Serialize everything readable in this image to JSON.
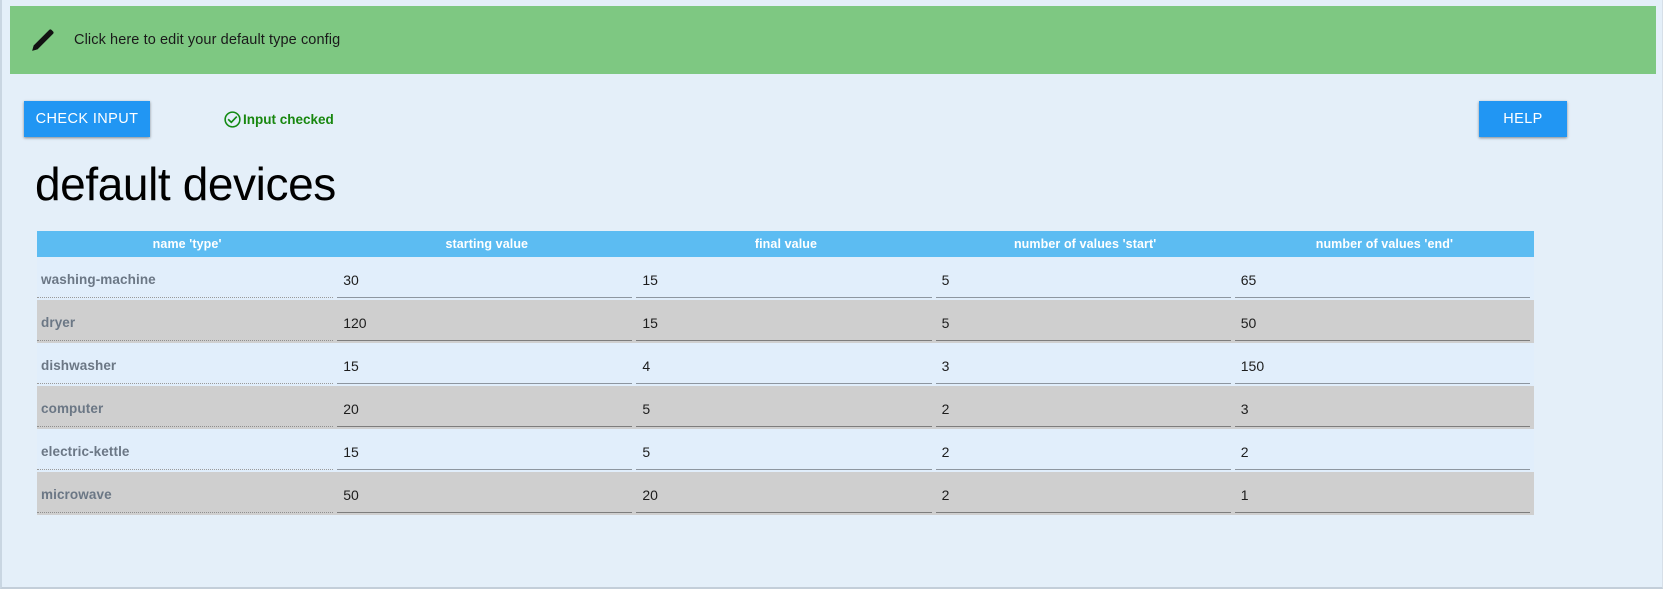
{
  "banner": {
    "icon": "pencil-icon",
    "label": "Click here to edit your default type config",
    "background": "#7ec882"
  },
  "toolbar": {
    "check_input_label": "CHECK INPUT",
    "help_label": "HELP",
    "status_icon": "check-circle-icon",
    "status_label": "Input checked",
    "status_color": "#18870f",
    "button_color": "#2196f3"
  },
  "page": {
    "title": "default devices",
    "background": "#e4eff9"
  },
  "table": {
    "header_color": "#5cbcf2",
    "row_odd_color": "#e1eefb",
    "row_even_color": "#cfcfcf",
    "columns": [
      "name 'type'",
      "starting value",
      "final value",
      "number of values 'start'",
      "number of values 'end'"
    ],
    "rows": [
      {
        "name": "washing-machine",
        "starting_value": "30",
        "final_value": "15",
        "values_start": "5",
        "values_end": "65"
      },
      {
        "name": "dryer",
        "starting_value": "120",
        "final_value": "15",
        "values_start": "5",
        "values_end": "50"
      },
      {
        "name": "dishwasher",
        "starting_value": "15",
        "final_value": "4",
        "values_start": "3",
        "values_end": "150"
      },
      {
        "name": "computer",
        "starting_value": "20",
        "final_value": "5",
        "values_start": "2",
        "values_end": "3"
      },
      {
        "name": "electric-kettle",
        "starting_value": "15",
        "final_value": "5",
        "values_start": "2",
        "values_end": "2"
      },
      {
        "name": "microwave",
        "starting_value": "50",
        "final_value": "20",
        "values_start": "2",
        "values_end": "1"
      }
    ]
  }
}
